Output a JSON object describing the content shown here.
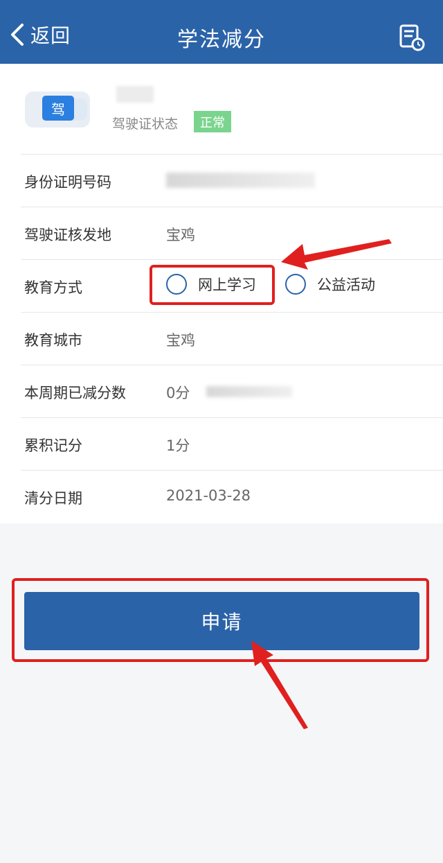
{
  "header": {
    "back_label": "返回",
    "title": "学法减分"
  },
  "license": {
    "badge_text": "驾",
    "status_label": "驾驶证状态",
    "status_value": "正常"
  },
  "fields": {
    "id_number_label": "身份证明号码",
    "issue_place_label": "驾驶证核发地",
    "issue_place_value": "宝鸡",
    "education_mode_label": "教育方式",
    "education_city_label": "教育城市",
    "education_city_value": "宝鸡",
    "reduced_points_label": "本周期已减分数",
    "reduced_points_value": "0分",
    "accumulated_points_label": "累积记分",
    "accumulated_points_value": "1分",
    "clear_date_label": "清分日期",
    "clear_date_value": "2021-03-28"
  },
  "education_options": [
    "网上学习",
    "公益活动"
  ],
  "apply_label": "申请",
  "colors": {
    "primary": "#2b63a8",
    "status_badge": "#7ad48e",
    "annotation": "#e0201e"
  }
}
